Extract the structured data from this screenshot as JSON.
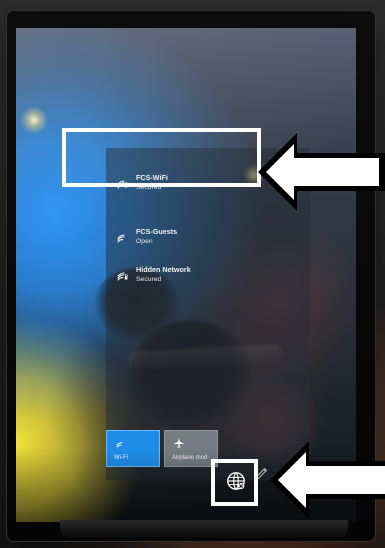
{
  "network_flyout": {
    "networks": [
      {
        "name": "FCS-WiFi",
        "status": "Secured",
        "icon": "wifi-signal-icon"
      },
      {
        "name": "FCS-Guests",
        "status": "Open",
        "icon": "wifi-signal-icon"
      },
      {
        "name": "Hidden Network",
        "status": "Secured",
        "icon": "wifi-signal-icon"
      }
    ],
    "quick_actions": [
      {
        "label": "Wi-Fi",
        "icon": "wifi-tile-icon",
        "active": true
      },
      {
        "label": "Airplane mod",
        "icon": "airplane-icon",
        "active": false
      }
    ]
  },
  "taskbar": {
    "network_tray_icon": "globe-network-icon"
  },
  "annotations": {
    "arrow_icon": "left-arrow-icon",
    "highlight_color": "#ffffff"
  },
  "colors": {
    "wifi_tile": "#1f8de8",
    "airplane_tile": "#9ba2aa",
    "text": "#f2f2f2"
  }
}
